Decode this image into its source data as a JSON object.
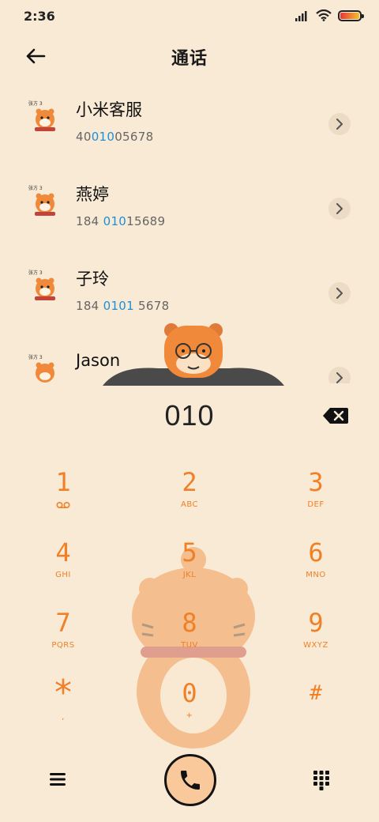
{
  "status_bar": {
    "time": "2:36",
    "icons": [
      "signal-icon",
      "wifi-icon",
      "battery-icon"
    ]
  },
  "header": {
    "title": "通话",
    "back_icon": "back-arrow-icon"
  },
  "contacts": [
    {
      "name": "小米客服",
      "number_parts": [
        "40",
        "010",
        "05678"
      ]
    },
    {
      "name": "燕婷",
      "number_parts": [
        "184 ",
        "010",
        "15689"
      ]
    },
    {
      "name": "子玲",
      "number_parts": [
        "184 ",
        "0101",
        " 5678"
      ]
    },
    {
      "name": "Jason",
      "number_parts": [
        "",
        "",
        ""
      ]
    }
  ],
  "dial": {
    "number": "010",
    "backspace_icon": "backspace-icon"
  },
  "keypad": [
    {
      "digit": "1",
      "letters": "",
      "icon": "voicemail-icon"
    },
    {
      "digit": "2",
      "letters": "ABC"
    },
    {
      "digit": "3",
      "letters": "DEF"
    },
    {
      "digit": "4",
      "letters": "GHI"
    },
    {
      "digit": "5",
      "letters": "JKL"
    },
    {
      "digit": "6",
      "letters": "MNO"
    },
    {
      "digit": "7",
      "letters": "PQRS"
    },
    {
      "digit": "8",
      "letters": "TUV"
    },
    {
      "digit": "9",
      "letters": "WXYZ"
    },
    {
      "digit": "*",
      "letters": ","
    },
    {
      "digit": "0",
      "letters": "+"
    },
    {
      "digit": "#",
      "letters": ""
    }
  ],
  "bottom_bar": {
    "menu_icon": "menu-icon",
    "call_icon": "phone-icon",
    "dialpad_icon": "dialpad-icon"
  },
  "colors": {
    "background": "#f9ead5",
    "key_accent": "#f07f25",
    "number_highlight": "#1c8fd9",
    "call_button": "#f9c99c"
  }
}
